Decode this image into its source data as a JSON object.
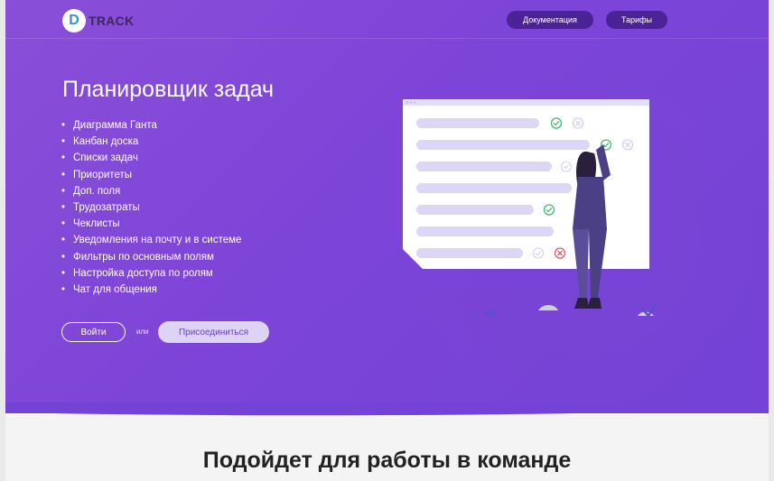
{
  "header": {
    "logo_letter": "D",
    "logo_text": "TRACK",
    "nav": [
      {
        "label": "Документация"
      },
      {
        "label": "Тарифы"
      }
    ]
  },
  "hero": {
    "title": "Планировщик задач",
    "features": [
      "Диаграмма Ганта",
      "Канбан доска",
      "Списки задач",
      "Приоритеты",
      "Доп. поля",
      "Трудозатраты",
      "Чеклисты",
      "Уведомления на почту и в системе",
      "Фильтры по основным полям",
      "Настройка доступа по ролям",
      "Чат для общения"
    ],
    "bullet": "•",
    "login_label": "Войти",
    "or_label": "или",
    "join_label": "Присоединиться"
  },
  "section": {
    "title": "Подойдет для работы в команде"
  },
  "colors": {
    "hero_bg": "#7d44d8",
    "nav_button": "#4c2396",
    "join_button": "#ddd3f5",
    "check_green": "#3fbf6a",
    "cross_red": "#e05a6a"
  }
}
